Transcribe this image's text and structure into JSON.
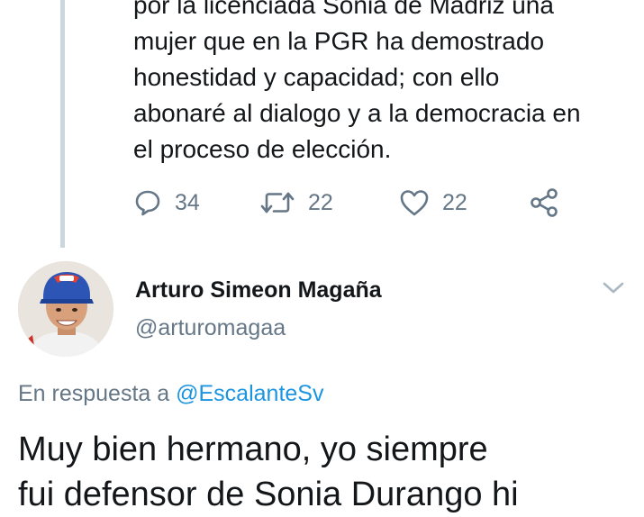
{
  "tweet": {
    "lines": [
      "por la licenciada Sonia de Madriz una",
      "mujer que en la PGR ha demostrado",
      "honestidad y capacidad; con ello",
      "abonaré al dialogo y a la democracia en",
      "el proceso de elección."
    ],
    "actions": {
      "reply_icon": "comment-icon",
      "reply_count": "34",
      "retweet_icon": "retweet-icon",
      "retweet_count": "22",
      "like_icon": "heart-icon",
      "like_count": "22",
      "share_icon": "share-icon"
    }
  },
  "reply": {
    "author": {
      "display_name": "Arturo Simeon Magaña",
      "handle": "@arturomagaa",
      "avatar_icon": "user-avatar"
    },
    "menu_icon": "chevron-down-icon",
    "in_reply_to_prefix": "En respuesta a",
    "in_reply_to_mention": "@EscalanteSv",
    "body_lines": [
      "Muy bien hermano, yo siempre",
      "fui defensor de Sonia Durango hi"
    ]
  },
  "colors": {
    "text": "#14171a",
    "secondary": "#657786",
    "link": "#1b95e0",
    "thread_line": "#ccd6dd"
  }
}
